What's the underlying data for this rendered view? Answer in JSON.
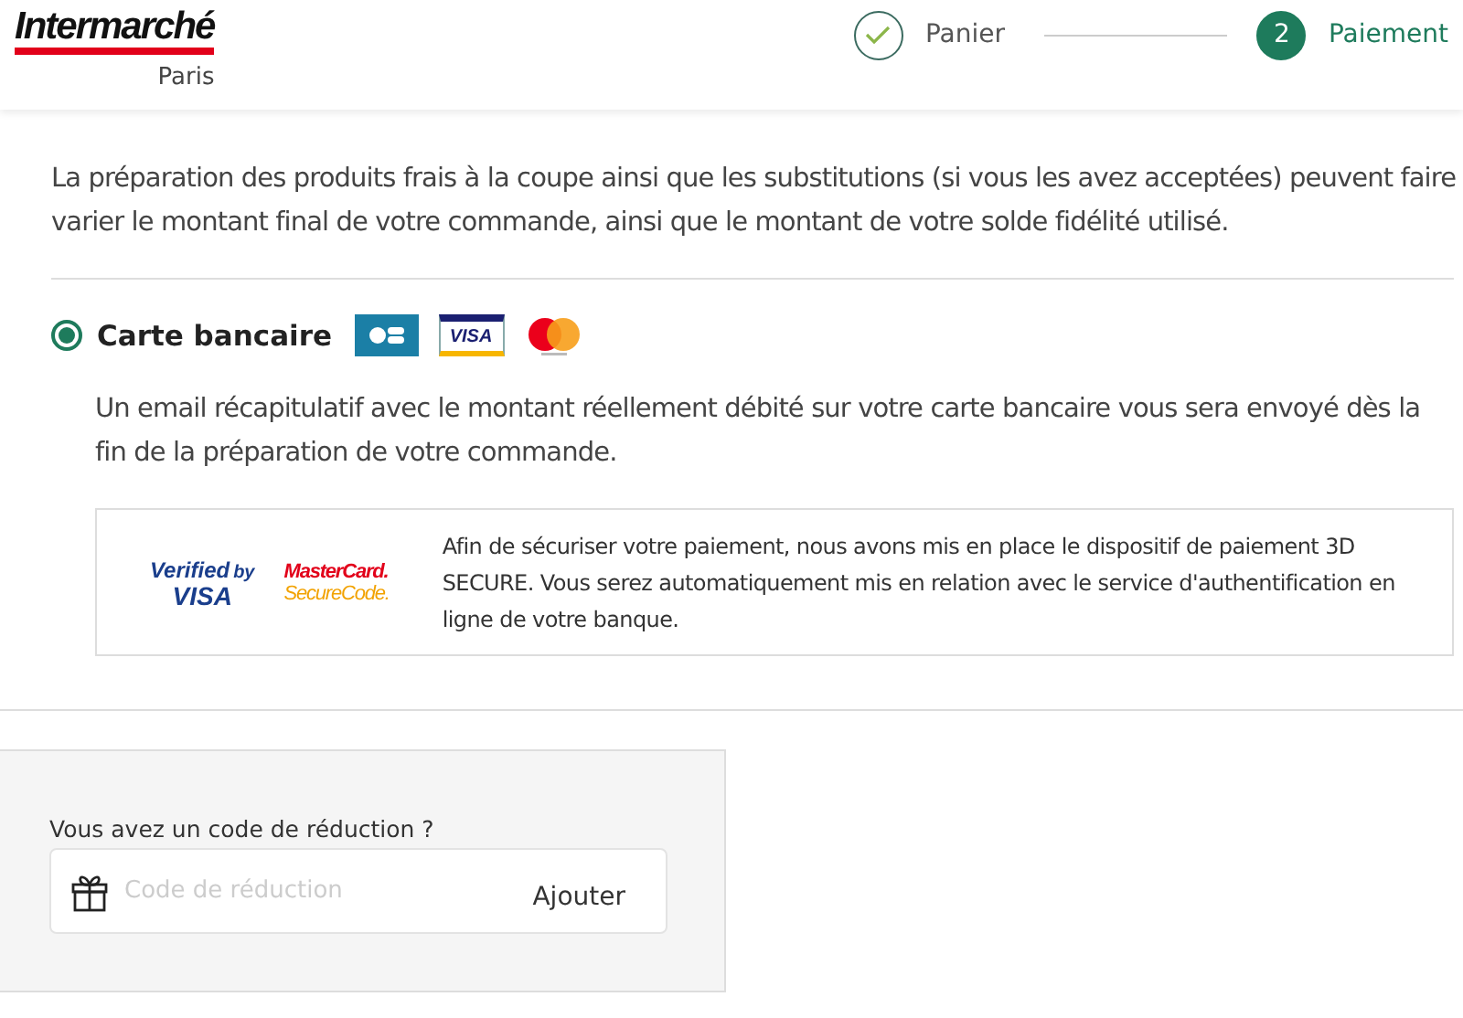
{
  "header": {
    "logo": "Intermarché",
    "store": "Paris",
    "steps": [
      {
        "label": "Panier",
        "done": true,
        "selected": false
      },
      {
        "label": "Paiement",
        "number": "2",
        "done": false,
        "selected": true
      }
    ]
  },
  "intro": "La préparation des produits frais à la coupe ainsi que les substitutions (si vous les avez acceptées) peuvent faire varier le montant final de votre commande, ainsi que le montant de votre solde fidélité utilisé.",
  "payment_options": [
    {
      "label": "Carte bancaire",
      "selected": true,
      "visa_logo": "VISA",
      "note": "Un email récapitulatif avec le montant réellement débité sur votre carte bancaire vous sera envoyé dès la fin de la préparation de votre commande.",
      "secure": {
        "verified_top": "Verified",
        "verified_by": "by",
        "verified_visa": "VISA",
        "mc_top": "MasterCard.",
        "mc_bottom": "SecureCode.",
        "text": "Afin de sécuriser votre paiement, nous avons mis en place le dispositif de paiement 3D SECURE. Vous serez automatiquement mis en relation avec le service d'authentification en ligne de votre banque."
      }
    }
  ],
  "promo": {
    "label": "Vous avez un code de réduction ?",
    "placeholder": "Code de réduction",
    "button": "Ajouter"
  }
}
